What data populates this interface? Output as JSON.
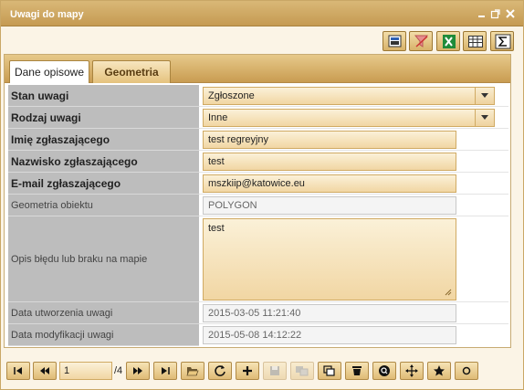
{
  "window": {
    "title": "Uwagi do mapy",
    "controls": [
      "minimize-icon",
      "restore-icon",
      "close-icon"
    ]
  },
  "toolbar": {
    "icons": [
      "print-preview-icon",
      "clear-filter-icon",
      "excel-export-icon",
      "table-view-icon",
      "sum-icon"
    ]
  },
  "tabs": [
    {
      "label": "Dane opisowe",
      "active": true
    },
    {
      "label": "Geometria",
      "active": false
    }
  ],
  "form": {
    "rows": [
      {
        "label": "Stan uwagi",
        "value": "Zgłoszone",
        "bold": true,
        "type": "select"
      },
      {
        "label": "Rodzaj uwagi",
        "value": "Inne",
        "bold": true,
        "type": "select"
      },
      {
        "label": "Imię zgłaszającego",
        "value": "test regreyjny",
        "bold": true,
        "type": "text"
      },
      {
        "label": "Nazwisko zgłaszającego",
        "value": "test",
        "bold": true,
        "type": "text"
      },
      {
        "label": "E-mail zgłaszającego",
        "value": "mszkiip@katowice.eu",
        "bold": true,
        "type": "text"
      },
      {
        "label": "Geometria obiektu",
        "value": "POLYGON",
        "bold": false,
        "type": "readonly"
      },
      {
        "label": "Opis błędu lub braku na mapie",
        "value": "test",
        "bold": false,
        "type": "textarea"
      },
      {
        "label": "Data utworzenia uwagi",
        "value": "2015-03-05 11:21:40",
        "bold": false,
        "type": "readonly"
      },
      {
        "label": "Data modyfikacji uwagi",
        "value": "2015-05-08 14:12:22",
        "bold": false,
        "type": "readonly"
      }
    ]
  },
  "pager": {
    "current_page": "1",
    "total": "/4",
    "buttons": [
      "first-page-icon",
      "prev-page-icon",
      "next-page-icon",
      "last-page-icon"
    ]
  },
  "actions": {
    "icons": [
      "open-folder-icon",
      "refresh-icon",
      "add-icon",
      "save-icon",
      "copy-disabled-icon",
      "duplicate-icon",
      "delete-icon",
      "zoom-to-icon",
      "pan-icon",
      "star-icon",
      "circle-icon"
    ]
  },
  "colors": {
    "title_bar": "#c59a52",
    "label_bg": "#bdbdbd",
    "field_bg": "#f1d6a3",
    "field_border": "#d0aa63"
  }
}
